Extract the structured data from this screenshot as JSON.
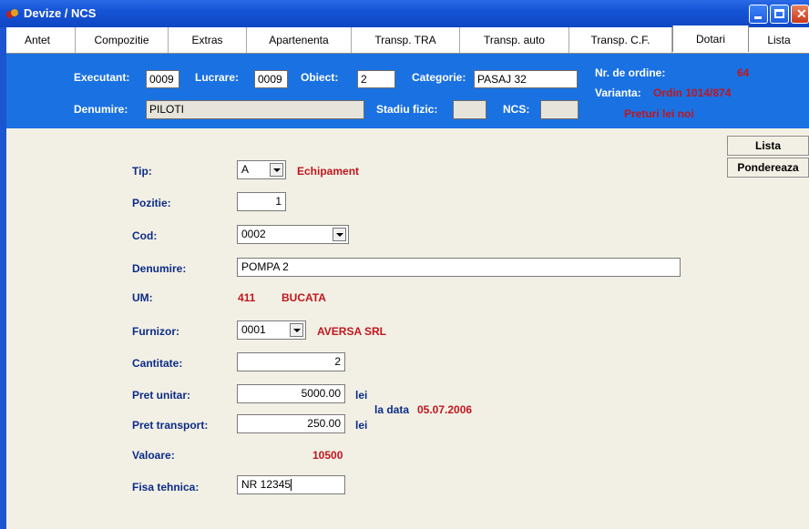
{
  "window": {
    "title": "Devize / NCS"
  },
  "tabs": [
    "Antet",
    "Compozitie",
    "Extras",
    "Apartenenta",
    "Transp. TRA",
    "Transp. auto",
    "Transp. C.F.",
    "Dotari",
    "Lista"
  ],
  "header": {
    "executant_label": "Executant:",
    "executant_value": "0009",
    "lucrare_label": "Lucrare:",
    "lucrare_value": "0009",
    "obiect_label": "Obiect:",
    "obiect_value": "2",
    "categorie_label": "Categorie:",
    "categorie_value": "PASAJ 32",
    "nr_ordine_label": "Nr. de ordine:",
    "nr_ordine_value": "64",
    "varianta_label": "Varianta:",
    "varianta_value": "Ordin 1014/874",
    "preturi": "Preturi lei noi",
    "denumire_label": "Denumire:",
    "denumire_value": "PILOTI",
    "stadiu_label": "Stadiu fizic:",
    "stadiu_value": "",
    "ncs_label": "NCS:",
    "ncs_value": ""
  },
  "form": {
    "tip_label": "Tip:",
    "tip_value": "A",
    "tip_desc": "Echipament",
    "pozitie_label": "Pozitie:",
    "pozitie_value": "1",
    "cod_label": "Cod:",
    "cod_value": "0002",
    "denumire_label": "Denumire:",
    "denumire_value": "POMPA 2",
    "um_label": "UM:",
    "um_code": "411",
    "um_desc": "BUCATA",
    "furnizor_label": "Furnizor:",
    "furnizor_value": "0001",
    "furnizor_desc": "AVERSA SRL",
    "cantitate_label": "Cantitate:",
    "cantitate_value": "2",
    "pret_unitar_label": "Pret unitar:",
    "pret_unitar_value": "5000.00",
    "lei1": "lei",
    "la_data_label": "la data",
    "la_data_value": "05.07.2006",
    "pret_transport_label": "Pret transport:",
    "pret_transport_value": "250.00",
    "lei2": "lei",
    "valoare_label": "Valoare:",
    "valoare_value": "10500",
    "fisa_label": "Fisa tehnica:",
    "fisa_value": "NR 12345"
  },
  "buttons": {
    "lista": "Lista",
    "ponderare": "Pondereaza"
  }
}
